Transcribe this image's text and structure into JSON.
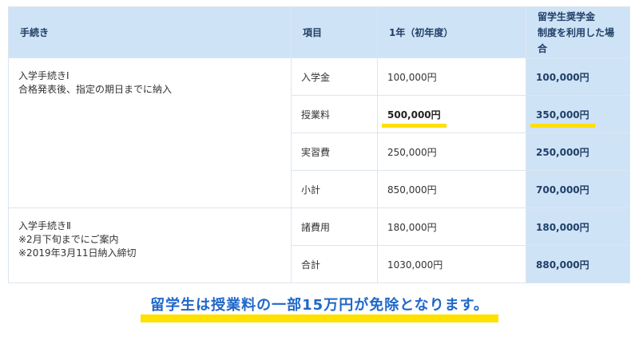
{
  "table": {
    "headers": {
      "procedure": "手続き",
      "item": "項目",
      "first_year": "1年（初年度）",
      "scholarship_line1": "留学生奨学金",
      "scholarship_line2": "制度を利用した場合"
    },
    "groups": [
      {
        "procedure_lines": [
          "入学手続きⅠ",
          "合格発表後、指定の期日までに納入"
        ],
        "rows": [
          {
            "item": "入学金",
            "first_year": "100,000円",
            "scholarship": "100,000円"
          },
          {
            "item": "授業料",
            "first_year": "500,000円",
            "scholarship": "350,000円",
            "highlighted": true
          },
          {
            "item": "実習費",
            "first_year": "250,000円",
            "scholarship": "250,000円"
          },
          {
            "item": "小計",
            "first_year": "850,000円",
            "scholarship": "700,000円"
          }
        ]
      },
      {
        "procedure_lines": [
          "入学手続きⅡ",
          "※2月下旬までにご案内",
          "※2019年3月11日納入締切"
        ],
        "rows": [
          {
            "item": "諸費用",
            "first_year": "180,000円",
            "scholarship": "180,000円"
          },
          {
            "item": "合計",
            "first_year": "1030,000円",
            "scholarship": "880,000円"
          }
        ]
      }
    ]
  },
  "note": "留学生は授業料の一部15万円が免除となります。",
  "colors": {
    "header_bg": "#cfe3f7",
    "header_text": "#1f3f66",
    "highlight": "#ffe000",
    "note_text": "#1f67c9"
  }
}
